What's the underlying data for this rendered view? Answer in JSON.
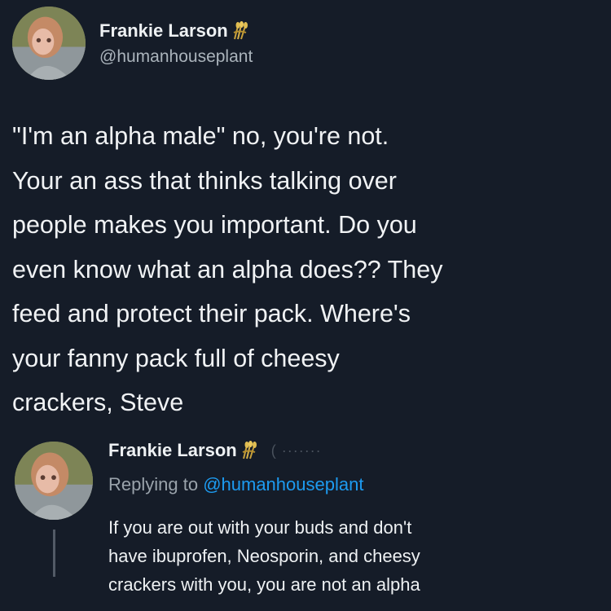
{
  "main_tweet": {
    "display_name": "Frankie Larson",
    "name_icon": "wheat-sheaf-icon",
    "handle": "@humanhouseplant",
    "text_lines": [
      "\"I'm an alpha male\" no, you're not.",
      "Your an ass that thinks talking over",
      "people makes you important. Do you",
      "even know what an alpha does?? They",
      "feed and protect their pack. Where's",
      "your fanny pack full of cheesy",
      "crackers, Steve"
    ]
  },
  "reply_tweet": {
    "display_name": "Frankie Larson",
    "name_icon": "wheat-sheaf-icon",
    "faded_text": "( ·······",
    "replying_prefix": "Replying to ",
    "replying_handle": "@humanhouseplant",
    "text_lines": [
      "If you are out with your buds and don't",
      "have ibuprofen, Neosporin, and cheesy",
      "crackers with you, you are not an alpha"
    ]
  },
  "colors": {
    "background": "#151c28",
    "text": "#f0f2f4",
    "secondary_text": "#aab3bb",
    "link": "#1d9bf0"
  }
}
